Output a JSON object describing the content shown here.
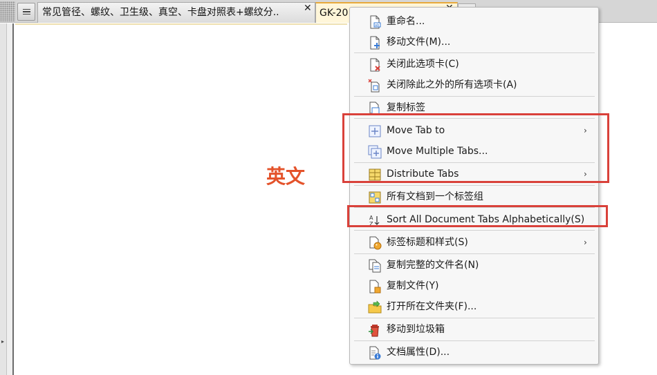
{
  "tabs": {
    "tab1_label": "常见管径、螺纹、卫生级、真空、卡盘对照表+螺纹分..",
    "tab2_label": "GK-20"
  },
  "document": {
    "heading": "英文"
  },
  "menu": {
    "rename": "重命名...",
    "move_file": "移动文件(M)...",
    "close_tab": "关闭此选项卡(C)",
    "close_others": "关闭除此之外的所有选项卡(A)",
    "copy_tab": "复制标签",
    "move_tab_to": "Move Tab to",
    "move_multiple": "Move Multiple Tabs...",
    "distribute": "Distribute Tabs",
    "all_docs_group": "所有文档到一个标签组",
    "sort_alpha": "Sort All Document Tabs Alphabetically(S)",
    "tab_title_style": "标签标题和样式(S)",
    "copy_full_name": "复制完整的文件名(N)",
    "copy_file": "复制文件(Y)",
    "open_folder": "打开所在文件夹(F)...",
    "move_trash": "移动到垃圾箱",
    "doc_props": "文档属性(D)...",
    "submenu_arrow": "›"
  },
  "colors": {
    "highlight": "#d9413a",
    "heading": "#e4532b",
    "active_tab_accent": "#e8a93a"
  }
}
